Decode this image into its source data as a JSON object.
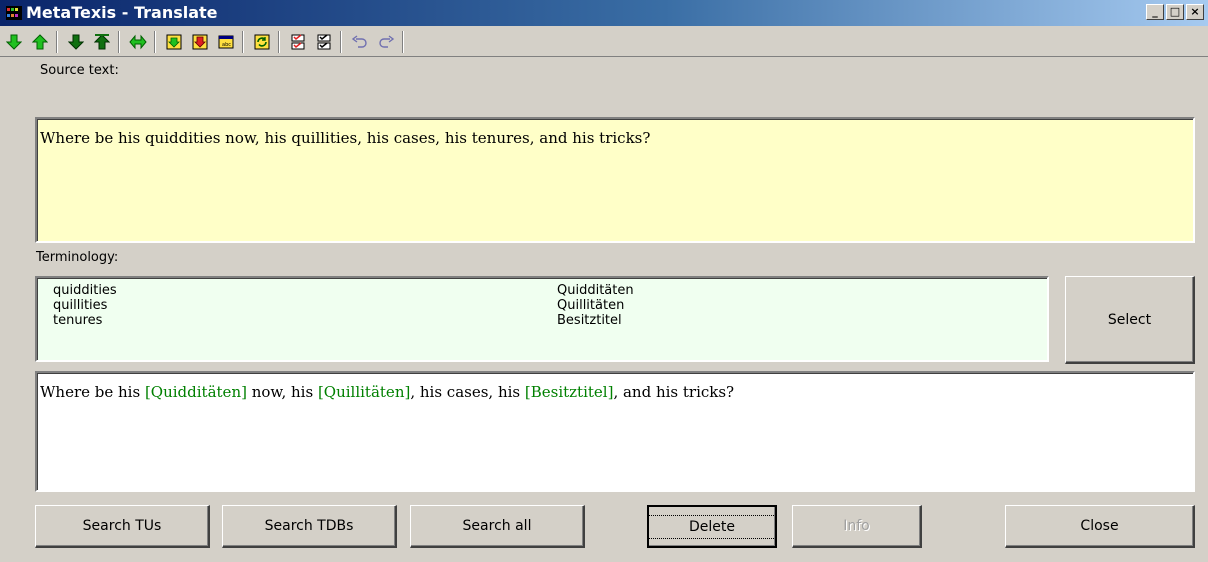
{
  "window": {
    "title": "MetaTexis - Translate",
    "controls": {
      "minimize": "_",
      "maximize": "□",
      "close": "×"
    }
  },
  "toolbar": {
    "icons": [
      "arrow-down-green-icon",
      "arrow-up-green-icon",
      "arrow-down-bar-icon",
      "arrow-up-bar-icon",
      "arrow-left-right-icon",
      "insert-yellow-icon",
      "insert-down-icon",
      "window-icon",
      "refresh-icon",
      "check-red-icon",
      "check-box-icon",
      "undo-icon",
      "redo-icon"
    ]
  },
  "source": {
    "label": "Source text:",
    "text": "Where be his quiddities now, his quillities, his cases, his tenures, and his tricks?"
  },
  "terminology": {
    "label": "Terminology:",
    "rows": [
      {
        "source": "quiddities",
        "target": "Quidditäten"
      },
      {
        "source": "quillities",
        "target": "Quillitäten"
      },
      {
        "source": "tenures",
        "target": "Besitztitel"
      }
    ],
    "select_label": "Select"
  },
  "target": {
    "parts": [
      "Where be his ",
      "[Quidditäten]",
      " now, his ",
      "[Quillitäten]",
      ", his cases, his ",
      "[Besitztitel]",
      ", and his tricks?"
    ]
  },
  "buttons": {
    "search_tus": "Search TUs",
    "search_tdbs": "Search TDBs",
    "search_all": "Search all",
    "delete": "Delete",
    "info": "Info",
    "close": "Close"
  },
  "colors": {
    "source_bg": "#ffffc8",
    "terminology_bg": "#f0fff0",
    "term_highlight": "#008000",
    "titlebar_start": "#0a246a"
  }
}
